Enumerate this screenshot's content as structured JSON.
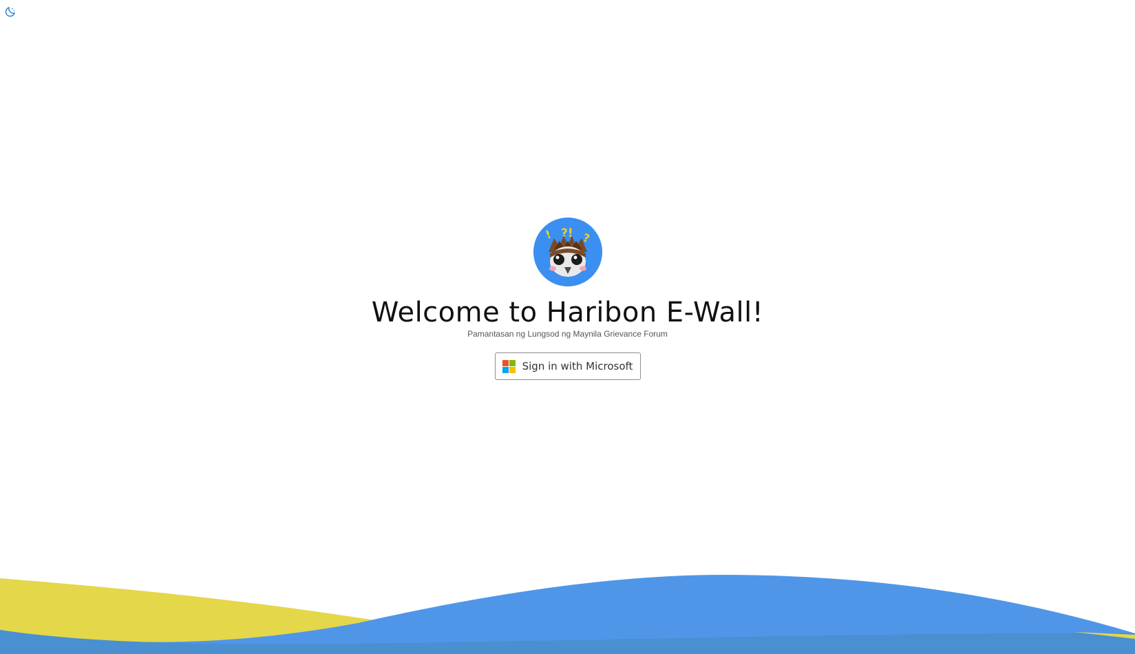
{
  "title": "Welcome to Haribon E-Wall!",
  "subtitle": "Pamantasan ng Lungsod ng Maynila Grievance Forum",
  "signin": {
    "label": "Sign in with Microsoft"
  },
  "icons": {
    "theme_toggle": "moon-icon",
    "logo": "haribon-owl-logo",
    "microsoft": "microsoft-logo"
  },
  "colors": {
    "accent_blue": "#3b8ff0",
    "wave_blue": "#5096e8",
    "wave_yellow": "#e4d74a",
    "ms_red": "#f25022",
    "ms_green": "#7fba00",
    "ms_blue": "#00a4ef",
    "ms_yellow": "#ffb900"
  }
}
